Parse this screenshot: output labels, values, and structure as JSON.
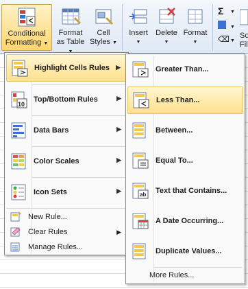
{
  "ribbon": {
    "conditional_formatting": [
      "Conditional",
      "Formatting"
    ],
    "format_as_table": [
      "Format",
      "as Table"
    ],
    "cell_styles": [
      "Cell",
      "Styles"
    ],
    "insert": "Insert",
    "delete": "Delete",
    "format": "Format",
    "truncated_label": [
      "So",
      "Fil"
    ]
  },
  "menu": {
    "items": [
      {
        "label": "Highlight Cells Rules",
        "icon": "highlight-cells-icon",
        "highlighted": true
      },
      {
        "label": "Top/Bottom Rules",
        "icon": "top-bottom-icon"
      },
      {
        "label": "Data Bars",
        "icon": "data-bars-icon"
      },
      {
        "label": "Color Scales",
        "icon": "color-scales-icon"
      },
      {
        "label": "Icon Sets",
        "icon": "icon-sets-icon"
      }
    ],
    "small_items": [
      {
        "label": "New Rule...",
        "icon": "new-rule-icon"
      },
      {
        "label": "Clear Rules",
        "icon": "clear-rules-icon"
      },
      {
        "label": "Manage Rules...",
        "icon": "manage-rules-icon"
      }
    ]
  },
  "submenu": {
    "items": [
      {
        "label": "Greater Than...",
        "icon": "greater-than-icon"
      },
      {
        "label": "Less Than...",
        "icon": "less-than-icon",
        "highlighted": true
      },
      {
        "label": "Between...",
        "icon": "between-icon"
      },
      {
        "label": "Equal To...",
        "icon": "equal-to-icon"
      },
      {
        "label": "Text that Contains...",
        "icon": "text-contains-icon"
      },
      {
        "label": "A Date Occurring...",
        "icon": "date-occurring-icon"
      },
      {
        "label": "Duplicate Values...",
        "icon": "duplicate-values-icon"
      }
    ],
    "more": "More Rules..."
  },
  "colors": {
    "highlight": "#ffe08b",
    "ribbon": "#dfe8f4"
  }
}
